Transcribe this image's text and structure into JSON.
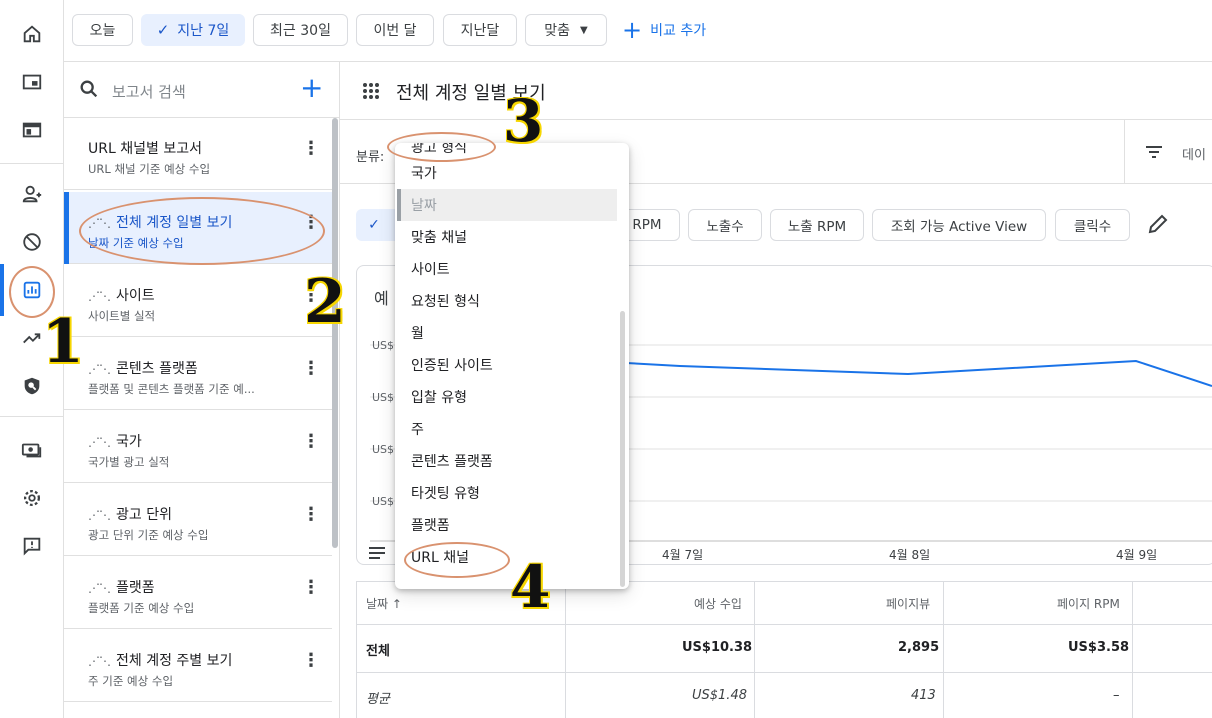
{
  "rail": {
    "icons": [
      "home-icon",
      "ad-frame-icon",
      "ad-unit-icon",
      "account-icon",
      "block-icon",
      "reports-icon",
      "trend-icon",
      "privacy-icon",
      "payments-icon",
      "settings-icon",
      "feedback-icon"
    ],
    "active": "reports-icon"
  },
  "topbar": {
    "chips": [
      "오늘",
      "지난 7일",
      "최근 30일",
      "이번 달",
      "지난달",
      "맞춤"
    ],
    "selected_chip": "지난 7일",
    "add_compare": "비교 추가"
  },
  "report_list": {
    "search_placeholder": "보고서 검색",
    "items": [
      {
        "title": "URL 채널별 보고서",
        "subtitle": "URL 채널 기준 예상 수입"
      },
      {
        "title": "전체 계정 일별 보기",
        "subtitle": "날짜 기준 예상 수입"
      },
      {
        "title": "사이트",
        "subtitle": "사이트별 실적"
      },
      {
        "title": "콘텐츠 플랫폼",
        "subtitle": "플랫폼 및 콘텐츠 플랫폼 기준 예..."
      },
      {
        "title": "국가",
        "subtitle": "국가별 광고 실적"
      },
      {
        "title": "광고 단위",
        "subtitle": "광고 단위 기준 예상 수입"
      },
      {
        "title": "플랫폼",
        "subtitle": "플랫폼 기준 예상 수입"
      },
      {
        "title": "전체 계정 주별 보기",
        "subtitle": "주 기준 예상 수입"
      }
    ]
  },
  "main": {
    "title": "전체 계정 일별 보기",
    "breakdown_label": "분류:",
    "filter_text": "데이",
    "metric_chips": [
      "RPM",
      "노출수",
      "노출 RPM",
      "조회 가능 Active View",
      "클릭수"
    ],
    "chart_title_cut": "예",
    "y_tick_prefix": "US$",
    "x_ticks": [
      "4월 7일",
      "4월 8일",
      "4월 9일"
    ]
  },
  "dropdown": {
    "cut_item": "광고 형식",
    "items": [
      "국가",
      "날짜",
      "맞춤 채널",
      "사이트",
      "요청된 형식",
      "월",
      "인증된 사이트",
      "입찰 유형",
      "주",
      "콘텐츠 플랫폼",
      "타겟팅 유형",
      "플랫폼",
      "URL 채널"
    ],
    "highlighted": "날짜"
  },
  "table": {
    "headers": [
      "날짜",
      "예상 수입",
      "페이지뷰",
      "페이지 RPM"
    ],
    "rows": [
      {
        "label": "전체",
        "values": [
          "US$10.38",
          "2,895",
          "US$3.58"
        ]
      },
      {
        "label": "평균",
        "values": [
          "US$1.48",
          "413",
          "–"
        ]
      }
    ]
  },
  "annotations": [
    "1",
    "2",
    "3",
    "4"
  ],
  "colors": {
    "accent": "#1a73e8",
    "annotation_circle": "#d9926f",
    "annotation_number_shadow": "#f6d600"
  }
}
